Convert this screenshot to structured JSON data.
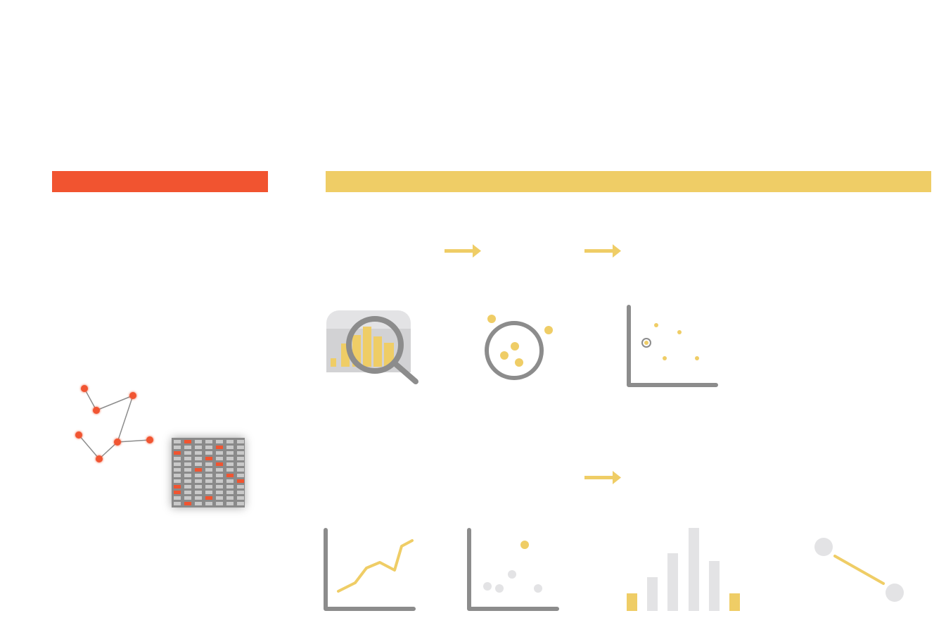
{
  "colors": {
    "orange": "#f15430",
    "yellow": "#efcd66",
    "gray": "#8c8c8c",
    "light_gray": "#e3e3e5",
    "cell_gray": "#c9c9c9",
    "grid_bg": "#8a8a8a"
  },
  "sections": {
    "left_bar_color": "#f15430",
    "right_bar_color": "#efcd66"
  },
  "icons": [
    "network-graph-icon",
    "data-matrix-icon",
    "magnifier-histogram-icon",
    "cluster-circle-icon",
    "scatter-highlight-icon",
    "line-chart-icon",
    "scatter-chart-icon",
    "bar-chart-icon",
    "dumbbell-connector-icon"
  ],
  "arrows": 3,
  "matrix": {
    "rows": 12,
    "cols": 7,
    "highlighted": [
      [
        0,
        1
      ],
      [
        1,
        4
      ],
      [
        2,
        0
      ],
      [
        3,
        3
      ],
      [
        4,
        4
      ],
      [
        5,
        2
      ],
      [
        6,
        5
      ],
      [
        7,
        6
      ],
      [
        8,
        0
      ],
      [
        9,
        0
      ],
      [
        10,
        3
      ],
      [
        11,
        1
      ]
    ]
  }
}
